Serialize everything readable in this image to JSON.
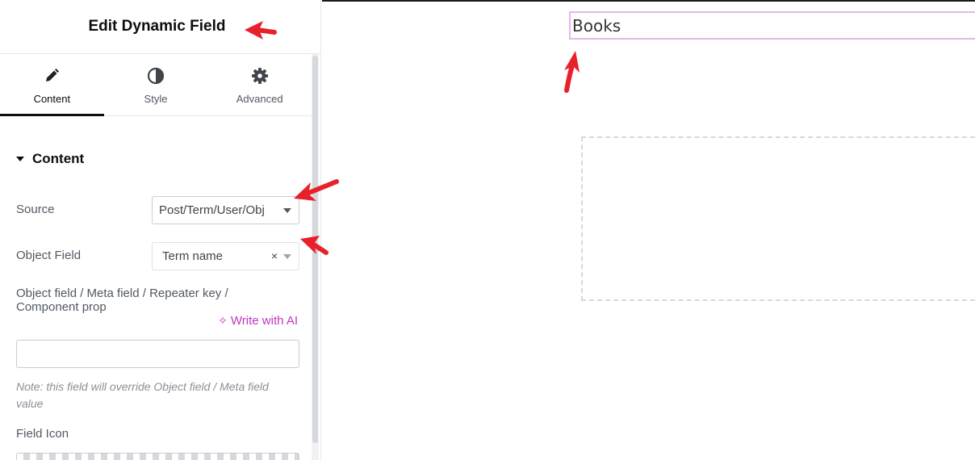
{
  "panel": {
    "title": "Edit Dynamic Field",
    "tabs": [
      {
        "label": "Content",
        "icon": "pencil-icon",
        "active": true
      },
      {
        "label": "Style",
        "icon": "half-circle-icon",
        "active": false
      },
      {
        "label": "Advanced",
        "icon": "gear-icon",
        "active": false
      }
    ]
  },
  "content_section": {
    "title": "Content",
    "source_label": "Source",
    "source_value": "Post/Term/User/Obj",
    "object_field_label": "Object Field",
    "object_field_value": "Term name",
    "object_field_clear": "×",
    "meta_field_label": "Object field / Meta field / Repeater key / Component prop",
    "ai_link": "Write with AI",
    "meta_field_value": "",
    "note": "Note: this field will override Object field / Meta field value",
    "field_icon_label": "Field Icon"
  },
  "preview": {
    "field_text": "Books"
  },
  "colors": {
    "accent_ai": "#c036c0",
    "annotation_arrow": "#e8202a",
    "field_outline": "#e7b4ec"
  }
}
